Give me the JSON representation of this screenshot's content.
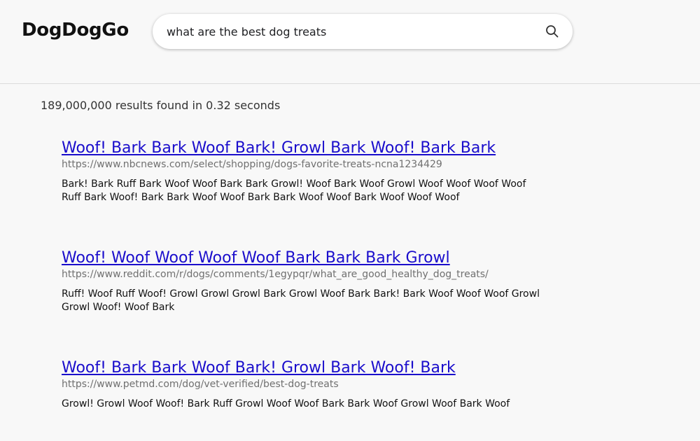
{
  "header": {
    "logo": "DogDogGo",
    "search_value": "what are the best dog treats",
    "search_icon": "search-icon"
  },
  "results_summary": "189,000,000 results found in 0.32 seconds",
  "results": [
    {
      "title": "Woof! Bark Bark Woof Bark! Growl Bark Woof! Bark Bark",
      "url": "https://www.nbcnews.com/select/shopping/dogs-favorite-treats-ncna1234429",
      "snippet": "Bark! Bark Ruff Bark Woof Woof Bark Bark Growl! Woof Bark Woof Growl Woof Woof Woof Woof Ruff Bark Woof! Bark Bark Woof Woof Bark Bark Woof Woof Bark Woof Woof Woof"
    },
    {
      "title": "Woof! Woof Woof Woof Woof Bark Bark Bark Growl",
      "url": "https://www.reddit.com/r/dogs/comments/1egypqr/what_are_good_healthy_dog_treats/",
      "snippet": "Ruff! Woof Ruff Woof! Growl Growl Growl Bark Growl Woof Bark Bark! Bark Woof Woof Woof Growl Growl Woof! Woof Bark"
    },
    {
      "title": "Woof! Bark Bark Woof Bark! Growl Bark Woof! Bark",
      "url": "https://www.petmd.com/dog/vet-verified/best-dog-treats",
      "snippet": "Growl! Growl Woof Woof! Bark Ruff Growl Woof Woof Bark Bark Woof Growl Woof Bark Woof"
    }
  ],
  "colors": {
    "link": "#1a0dcc",
    "url": "#707070",
    "background": "#f8f8f8"
  }
}
